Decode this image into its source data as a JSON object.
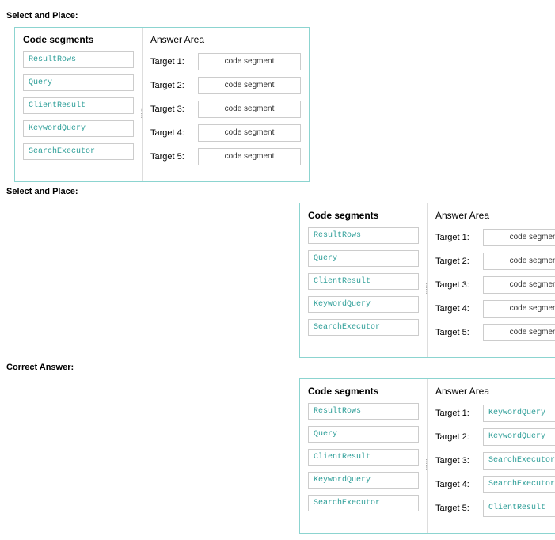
{
  "labels": {
    "select_and_place": "Select and Place:",
    "correct_answer": "Correct Answer:",
    "code_segments": "Code segments",
    "answer_area": "Answer Area",
    "placeholder": "code segment"
  },
  "segments": [
    "ResultRows",
    "Query",
    "ClientResult",
    "KeywordQuery",
    "SearchExecutor"
  ],
  "targets": [
    "Target 1:",
    "Target 2:",
    "Target 3:",
    "Target 4:",
    "Target 5:"
  ],
  "blocks": [
    {
      "heading": "select_and_place",
      "indent": "indent-1",
      "answers": [
        null,
        null,
        null,
        null,
        null
      ]
    },
    {
      "heading": "select_and_place",
      "indent": "indent-2",
      "answers": [
        null,
        null,
        null,
        null,
        null
      ]
    },
    {
      "heading": "correct_answer",
      "indent": "indent-2",
      "answers": [
        "KeywordQuery",
        "KeywordQuery",
        "SearchExecutor",
        "SearchExecutor",
        "ClientResult"
      ]
    }
  ]
}
